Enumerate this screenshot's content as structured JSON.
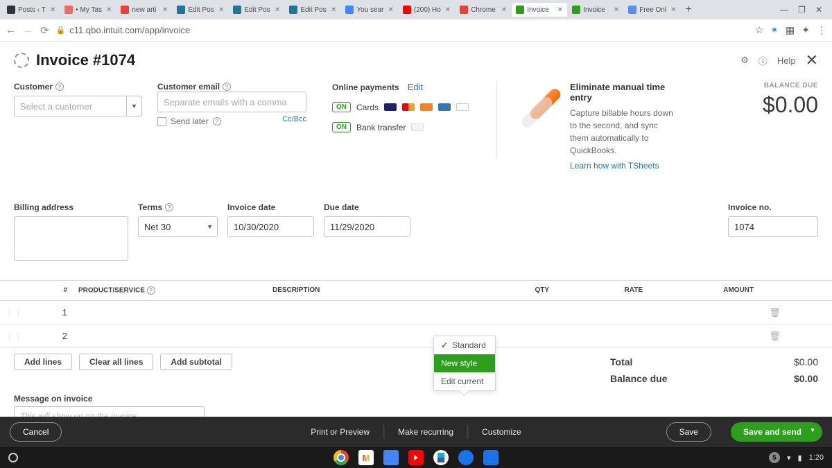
{
  "browser": {
    "tabs": [
      {
        "title": "Posts ‹ T"
      },
      {
        "title": "• My Tas"
      },
      {
        "title": "new arti"
      },
      {
        "title": "Edit Pos"
      },
      {
        "title": "Edit Pos"
      },
      {
        "title": "Edit Pos"
      },
      {
        "title": "You sear"
      },
      {
        "title": "(200) Ho"
      },
      {
        "title": "Chrome"
      },
      {
        "title": "Invoice"
      },
      {
        "title": "Invoice"
      },
      {
        "title": "Free Onl"
      }
    ],
    "url": "c11.qbo.intuit.com/app/invoice"
  },
  "header": {
    "title": "Invoice #1074",
    "help": "Help"
  },
  "form": {
    "customer_label": "Customer",
    "customer_placeholder": "Select a customer",
    "email_label": "Customer email",
    "email_placeholder": "Separate emails with a comma",
    "send_later": "Send later",
    "ccbcc": "Cc/Bcc",
    "online_payments": "Online payments",
    "edit": "Edit",
    "cards": "Cards",
    "bank_transfer": "Bank transfer",
    "on": "ON",
    "promo": {
      "title": "Eliminate manual time entry",
      "body": "Capture billable hours down to the second, and sync them automatically to QuickBooks.",
      "link": "Learn how with TSheets"
    },
    "balance_label": "BALANCE DUE",
    "balance_amount": "$0.00",
    "billing_label": "Billing address",
    "terms_label": "Terms",
    "terms_value": "Net 30",
    "invoice_date_label": "Invoice date",
    "invoice_date": "10/30/2020",
    "due_date_label": "Due date",
    "due_date": "11/29/2020",
    "invoice_no_label": "Invoice no.",
    "invoice_no": "1074"
  },
  "table": {
    "cols": {
      "num": "#",
      "prod": "PRODUCT/SERVICE",
      "desc": "DESCRIPTION",
      "qty": "QTY",
      "rate": "RATE",
      "amount": "AMOUNT"
    },
    "rows": [
      {
        "n": "1"
      },
      {
        "n": "2"
      }
    ],
    "add_lines": "Add lines",
    "clear_all": "Clear all lines",
    "add_subtotal": "Add subtotal",
    "total_label": "Total",
    "total": "$0.00",
    "balance_due_label": "Balance due",
    "balance_due": "$0.00"
  },
  "dropdown": {
    "standard": "Standard",
    "new_style": "New style",
    "edit_current": "Edit current"
  },
  "message": {
    "label": "Message on invoice",
    "placeholder": "This will show up on the invoice."
  },
  "bottom": {
    "cancel": "Cancel",
    "print": "Print or Preview",
    "recurring": "Make recurring",
    "customize": "Customize",
    "save": "Save",
    "save_send": "Save and send"
  },
  "taskbar": {
    "badge": "5",
    "time": "1:20"
  }
}
